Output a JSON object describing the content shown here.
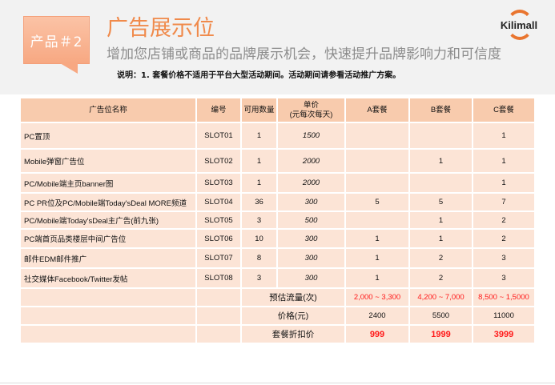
{
  "header": {
    "badge": "产品＃2",
    "title": "广告展示位",
    "subtitle": "增加您店铺或商品的品牌展示机会，快速提升品牌影响力和可信度",
    "note": "说明：1. 套餐价格不适用于平台大型活动期间。活动期间请参看活动推广方案。",
    "logo": "Kilimall",
    "brand_color": "#f08a4b"
  },
  "table": {
    "columns": [
      "广告位名称",
      "编号",
      "可用数量",
      "单价\n(元每次每天)",
      "A套餐",
      "B套餐",
      "C套餐"
    ],
    "rows": [
      [
        "PC置顶",
        "SLOT01",
        "1",
        "1500",
        "",
        "",
        "1"
      ],
      [
        "Mobile弹窗广告位",
        "SLOT02",
        "1",
        "2000",
        "",
        "1",
        "1"
      ],
      [
        "PC/Mobile端主页banner图",
        "SLOT03",
        "1",
        "2000",
        "",
        "",
        "1"
      ],
      [
        "PC PR位及PC/Mobile端Today'sDeal MORE频道",
        "SLOT04",
        "36",
        "300",
        "5",
        "5",
        "7"
      ],
      [
        "PC/Mobile端Today'sDeal主广告(前九张)",
        "SLOT05",
        "3",
        "500",
        "",
        "1",
        "2"
      ],
      [
        "PC端首页品类楼层中间广告位",
        "SLOT06",
        "10",
        "300",
        "1",
        "1",
        "2"
      ],
      [
        "邮件EDM邮件推广",
        "SLOT07",
        "8",
        "300",
        "1",
        "2",
        "3"
      ],
      [
        "社交媒体Facebook/Twitter发帖",
        "SLOT08",
        "3",
        "300",
        "1",
        "2",
        "3"
      ]
    ],
    "summary": [
      {
        "label": "预估流量(次)",
        "values": [
          "2,000 ~ 3,300",
          "4,200 ~ 7,000",
          "8,500 ~ 1,5000"
        ]
      },
      {
        "label": "价格(元)",
        "values": [
          "2400",
          "5500",
          "11000"
        ]
      },
      {
        "label": "套餐折扣价",
        "values": [
          "999",
          "1999",
          "3999"
        ]
      }
    ]
  }
}
